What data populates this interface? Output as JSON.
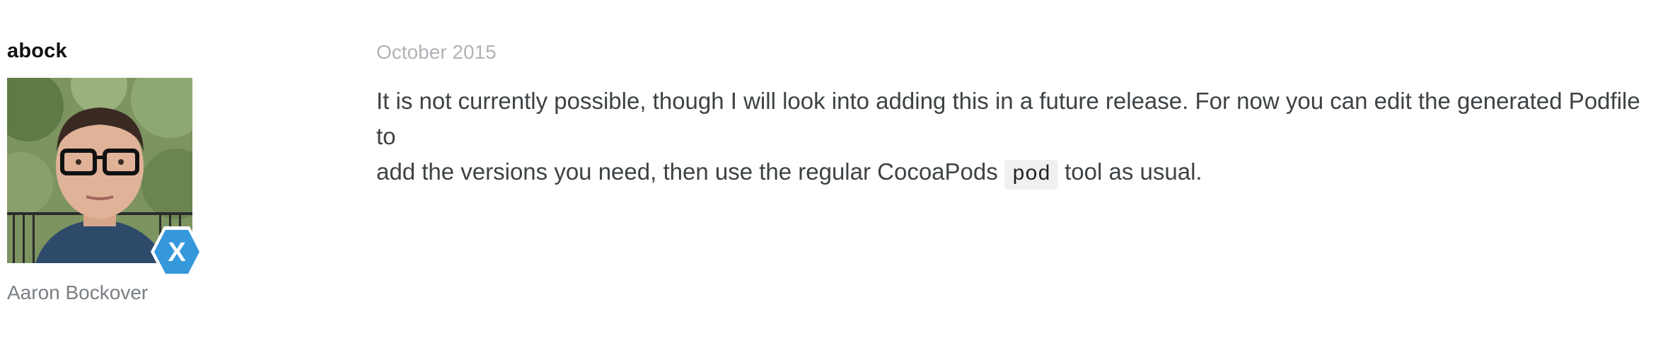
{
  "author": {
    "username": "abock",
    "display_name": "Aaron Bockover",
    "avatar_icon": "user-avatar-photo",
    "badge_icon": "xamarin-x-hexagon-icon",
    "badge_letter": "X",
    "badge_color": "#3498db"
  },
  "post": {
    "date": "October 2015",
    "text_line1": "It is not currently possible, though I will look into adding this in a future release. For now you can edit the generated Podfile to",
    "text_line2_before": "add the versions you need, then use the regular CocoaPods ",
    "code": "pod",
    "text_line2_after": " tool as usual."
  }
}
